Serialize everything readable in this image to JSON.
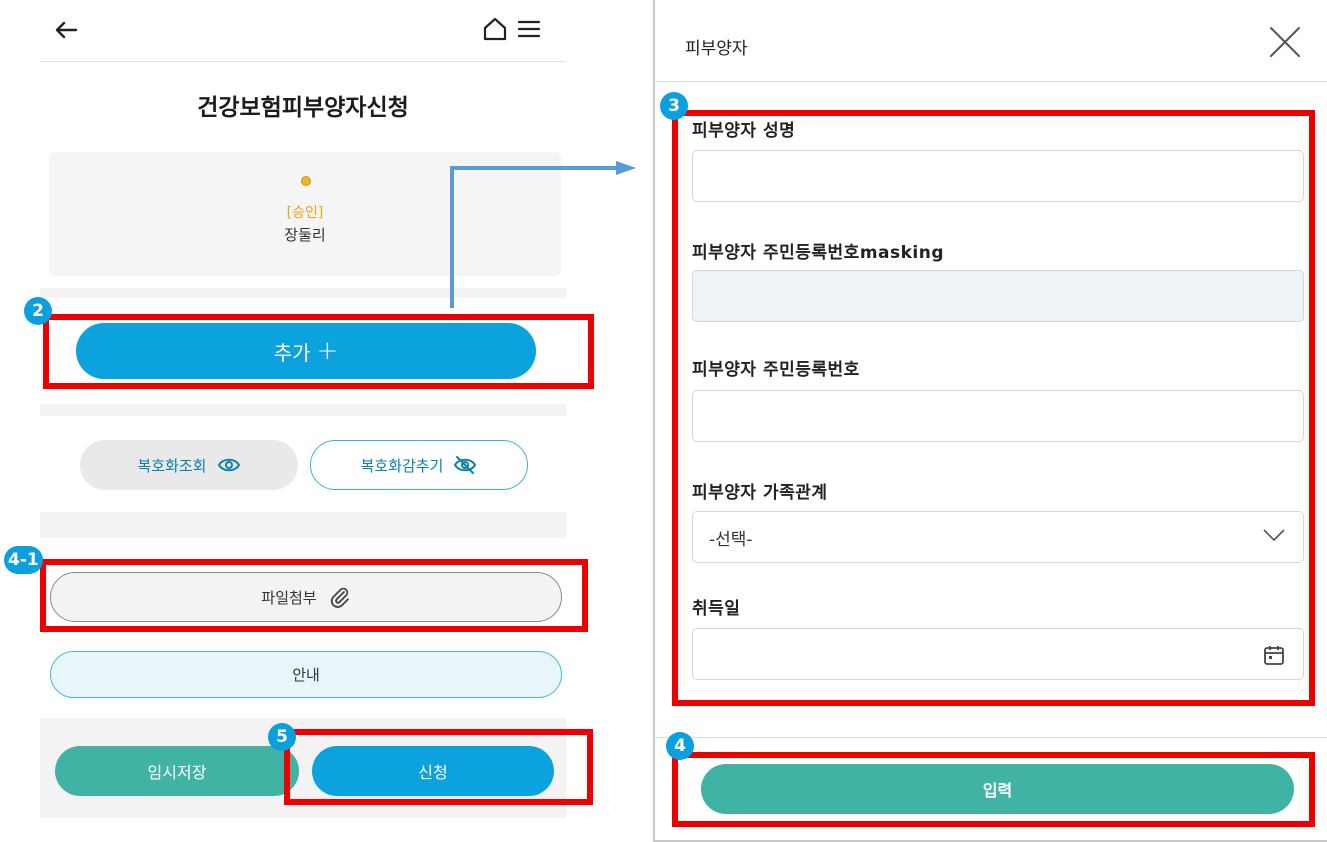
{
  "left": {
    "title": "건강보험피부양자신청",
    "card": {
      "status": "[승인]",
      "name": "장둘리"
    },
    "add_button": {
      "label": "추가",
      "icon": "plus-icon"
    },
    "decrypt_view": {
      "label": "복호화조회",
      "icon": "eye-icon"
    },
    "decrypt_hide": {
      "label": "복호화감추기",
      "icon": "eye-off-icon"
    },
    "file_attach": {
      "label": "파일첨부",
      "icon": "paperclip-icon"
    },
    "guide": {
      "label": "안내"
    },
    "temp_save": {
      "label": "임시저장"
    },
    "submit": {
      "label": "신청"
    }
  },
  "modal": {
    "title": "피부양자",
    "fields": {
      "name_label": "피부양자 성명",
      "rrn_masked_label": "피부양자 주민등록번호masking",
      "rrn_label": "피부양자 주민등록번호",
      "relation_label": "피부양자 가족관계",
      "relation_value": "-선택-",
      "acquire_date_label": "취득일"
    },
    "input_button": {
      "label": "입력"
    }
  },
  "annotations": {
    "badge_2": "2",
    "badge_3": "3",
    "badge_4": "4",
    "badge_4_1": "4-1",
    "badge_5": "5"
  },
  "colors": {
    "primary_blue": "#0ba2de",
    "teal": "#40b3a5",
    "highlight_red": "#ee0000",
    "status_yellow": "#e4a61d"
  }
}
